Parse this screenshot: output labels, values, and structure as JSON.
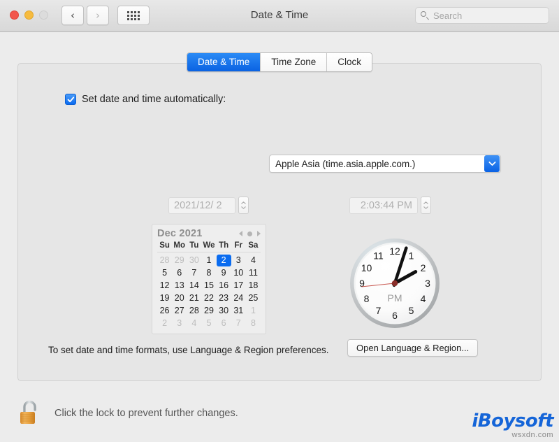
{
  "window": {
    "title": "Date & Time",
    "traffic_lights": [
      "close",
      "minimize",
      "zoom"
    ],
    "back_label": "‹",
    "forward_label": "›",
    "grid_label": "Show All"
  },
  "search": {
    "placeholder": "Search",
    "value": ""
  },
  "tabs": [
    {
      "label": "Date & Time",
      "active": true
    },
    {
      "label": "Time Zone",
      "active": false
    },
    {
      "label": "Clock",
      "active": false
    }
  ],
  "auto": {
    "checkbox_checked": true,
    "label": "Set date and time automatically:",
    "server_value": "Apple Asia (time.asia.apple.com.)"
  },
  "fields": {
    "date_value": "2021/12/ 2",
    "time_value": "2:03:44 PM",
    "disabled": true
  },
  "calendar": {
    "month_label": "Dec 2021",
    "weekdays": [
      "Su",
      "Mo",
      "Tu",
      "We",
      "Th",
      "Fr",
      "Sa"
    ],
    "weeks": [
      [
        {
          "d": "28",
          "muted": true
        },
        {
          "d": "29",
          "muted": true
        },
        {
          "d": "30",
          "muted": true
        },
        {
          "d": "1",
          "muted": false
        },
        {
          "d": "2",
          "muted": false,
          "selected": true
        },
        {
          "d": "3",
          "muted": false
        },
        {
          "d": "4",
          "muted": false
        }
      ],
      [
        {
          "d": "5"
        },
        {
          "d": "6"
        },
        {
          "d": "7"
        },
        {
          "d": "8"
        },
        {
          "d": "9"
        },
        {
          "d": "10"
        },
        {
          "d": "11"
        }
      ],
      [
        {
          "d": "12"
        },
        {
          "d": "13"
        },
        {
          "d": "14"
        },
        {
          "d": "15"
        },
        {
          "d": "16"
        },
        {
          "d": "17"
        },
        {
          "d": "18"
        }
      ],
      [
        {
          "d": "19"
        },
        {
          "d": "20"
        },
        {
          "d": "21"
        },
        {
          "d": "22"
        },
        {
          "d": "23"
        },
        {
          "d": "24"
        },
        {
          "d": "25"
        }
      ],
      [
        {
          "d": "26"
        },
        {
          "d": "27"
        },
        {
          "d": "28"
        },
        {
          "d": "29"
        },
        {
          "d": "30"
        },
        {
          "d": "31"
        },
        {
          "d": "1",
          "muted": true
        }
      ],
      [
        {
          "d": "2",
          "muted": true
        },
        {
          "d": "3",
          "muted": true
        },
        {
          "d": "4",
          "muted": true
        },
        {
          "d": "5",
          "muted": true
        },
        {
          "d": "6",
          "muted": true
        },
        {
          "d": "7",
          "muted": true
        },
        {
          "d": "8",
          "muted": true
        }
      ]
    ],
    "selected_day": "2",
    "prev_icon": "triangle-left-icon",
    "next_icon": "triangle-right-icon",
    "today_icon": "dot-icon"
  },
  "clock": {
    "meridiem": "PM",
    "hours": [
      "12",
      "1",
      "2",
      "3",
      "4",
      "5",
      "6",
      "7",
      "8",
      "9",
      "10",
      "11"
    ],
    "hour_hand_deg": 61,
    "minute_hand_deg": 18,
    "second_hand_deg": 264,
    "time_shown": "2:03:44 PM"
  },
  "footer": {
    "formats_note": "To set date and time formats, use Language & Region preferences.",
    "open_button": "Open Language & Region..."
  },
  "lock": {
    "state": "unlocked",
    "message": "Click the lock to prevent further changes."
  },
  "watermark": {
    "brand": "iBoysoft",
    "sub": "wsxdn.com"
  },
  "colors": {
    "accent_blue": "#0a6cf0",
    "tab_blue": "#1a7bf0",
    "lock_gold": "#e8a33d",
    "brand_blue": "#1565d8",
    "second_hand_red": "#c8564e"
  }
}
